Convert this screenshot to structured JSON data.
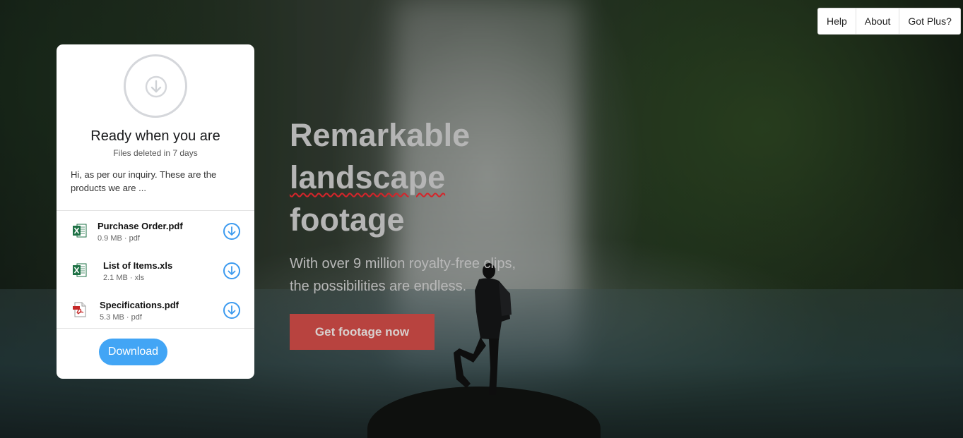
{
  "menu": {
    "items": [
      {
        "label": "Help"
      },
      {
        "label": "About"
      },
      {
        "label": "Got Plus?"
      }
    ]
  },
  "hero": {
    "title_line1": "Remarkable",
    "title_line2": "landscape",
    "title_line3": "footage",
    "subtitle_line1": "With over 9 million royalty-free clips,",
    "subtitle_line2": "the possibilities are endless.",
    "cta_label": "Get footage now",
    "cta_color": "#b8433f"
  },
  "card": {
    "icon": "download-icon",
    "title": "Ready when you are",
    "subtitle": "Files deleted in 7 days",
    "message": "Hi, as per our inquiry. These are the products we are ...",
    "files": [
      {
        "name": "Purchase Order.pdf",
        "size": "0.9 MB",
        "type": "pdf",
        "icon": "excel-file-icon"
      },
      {
        "name": "List of Items.xls",
        "size": "2.1 MB",
        "type": "xls",
        "icon": "excel-file-icon"
      },
      {
        "name": "Specifications.pdf",
        "size": "5.3 MB",
        "type": "pdf",
        "icon": "pdf-file-icon"
      }
    ],
    "meta_separator": "·",
    "download_label": "Download",
    "accent_color": "#42a5f5"
  }
}
